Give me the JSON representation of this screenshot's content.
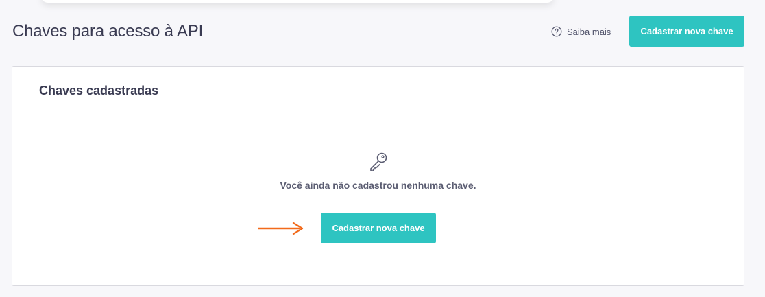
{
  "header": {
    "title": "Chaves para acesso à API",
    "help_icon": "question-circle-icon",
    "help_label": "Saiba mais",
    "primary_button_label": "Cadastrar nova chave"
  },
  "card": {
    "title": "Chaves cadastradas",
    "empty_state": {
      "icon": "key-icon",
      "message": "Você ainda não cadastrou nenhuma chave.",
      "button_label": "Cadastrar nova chave",
      "annotation_icon": "arrow-right-icon"
    }
  },
  "colors": {
    "accent": "#2ec4c1",
    "annotation_arrow": "#f26a1b",
    "background": "#f7f7fa",
    "text": "#3a3b52"
  }
}
